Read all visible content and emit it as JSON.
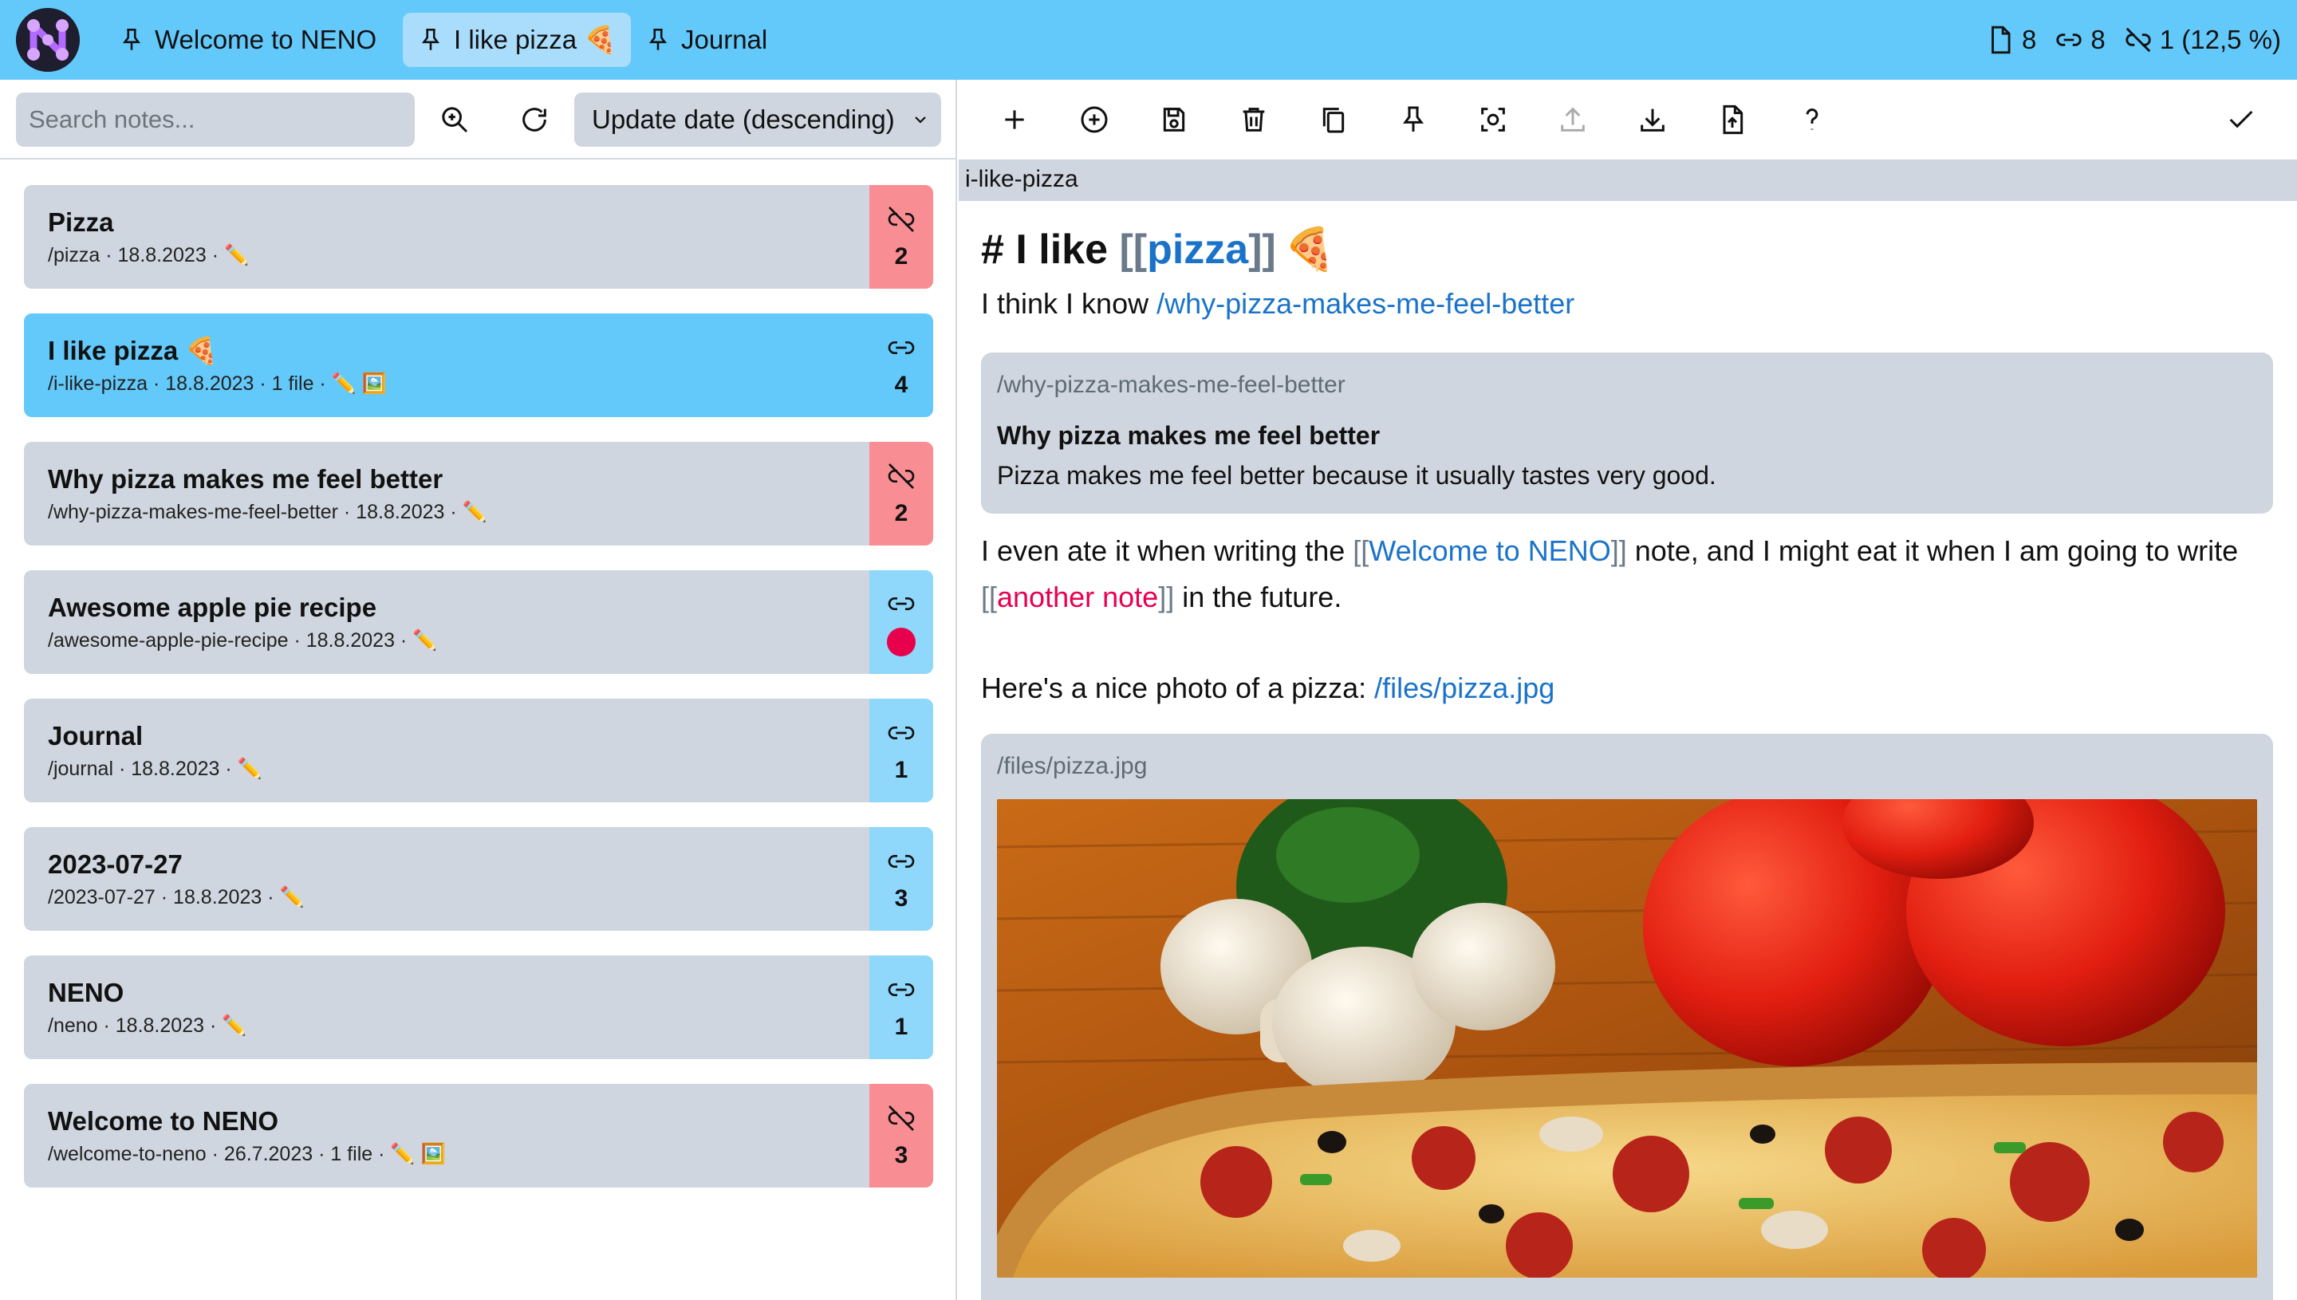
{
  "header": {
    "tabs": [
      {
        "label": "Welcome to NENO",
        "active": false
      },
      {
        "label": "I like pizza 🍕",
        "active": true
      },
      {
        "label": "Journal",
        "active": false
      }
    ],
    "stats": {
      "notes": "8",
      "links": "8",
      "unlinked": "1 (12,5 %)"
    }
  },
  "list_toolbar": {
    "search_placeholder": "Search notes...",
    "sort_value": "Update date (descending)"
  },
  "notes": [
    {
      "title": "Pizza",
      "meta": "/pizza · 18.8.2023 · ✏️",
      "count": "2",
      "kind": "unlinked",
      "selected": false
    },
    {
      "title": "I like pizza 🍕",
      "meta": "/i-like-pizza · 18.8.2023 · 1 file · ✏️ 🖼️",
      "count": "4",
      "kind": "linked",
      "selected": true
    },
    {
      "title": "Why pizza makes me feel better",
      "meta": "/why-pizza-makes-me-feel-better · 18.8.2023 · ✏️",
      "count": "2",
      "kind": "unlinked",
      "selected": false
    },
    {
      "title": "Awesome apple pie recipe",
      "meta": "/awesome-apple-pie-recipe · 18.8.2023 · ✏️",
      "count": "",
      "kind": "hub",
      "selected": false
    },
    {
      "title": "Journal",
      "meta": "/journal · 18.8.2023 · ✏️",
      "count": "1",
      "kind": "linked",
      "selected": false
    },
    {
      "title": "2023-07-27",
      "meta": "/2023-07-27 · 18.8.2023 · ✏️",
      "count": "3",
      "kind": "linked",
      "selected": false
    },
    {
      "title": "NENO",
      "meta": "/neno · 18.8.2023 · ✏️",
      "count": "1",
      "kind": "linked",
      "selected": false
    },
    {
      "title": "Welcome to NENO",
      "meta": "/welcome-to-neno · 26.7.2023 · 1 file · ✏️ 🖼️",
      "count": "3",
      "kind": "unlinked",
      "selected": false
    }
  ],
  "editor": {
    "slug": "i-like-pizza",
    "heading": {
      "hash": "# I like ",
      "open": "[[",
      "link": "pizza",
      "close": "]]",
      "emoji": "🍕"
    },
    "p1": {
      "text": "I think I know ",
      "link": "/why-pizza-makes-me-feel-better"
    },
    "transclusion1": {
      "slug": "/why-pizza-makes-me-feel-better",
      "title": "Why pizza makes me feel better",
      "body": "Pizza makes me feel better because it usually tastes very good."
    },
    "p2": {
      "a": "I even ate it when writing the ",
      "open1": "[[",
      "link1": "Welcome to NENO",
      "close1": "]]",
      "b": " note, and I might eat it when I am going to write ",
      "open2": "[[",
      "link2": "another note",
      "close2": "]]",
      "c": " in the future."
    },
    "p3": {
      "text": "Here's a nice photo of a pizza: ",
      "link": "/files/pizza.jpg"
    },
    "transclusion2": {
      "slug": "/files/pizza.jpg"
    }
  },
  "colors": {
    "header": "#63c9fb",
    "selected_note": "#63c9fb",
    "note_bg": "#cfd6df",
    "unlinked_badge": "#f88e93",
    "linked_badge": "#8fd7fb",
    "link": "#1a73c9",
    "broken_link": "#e8004d"
  }
}
